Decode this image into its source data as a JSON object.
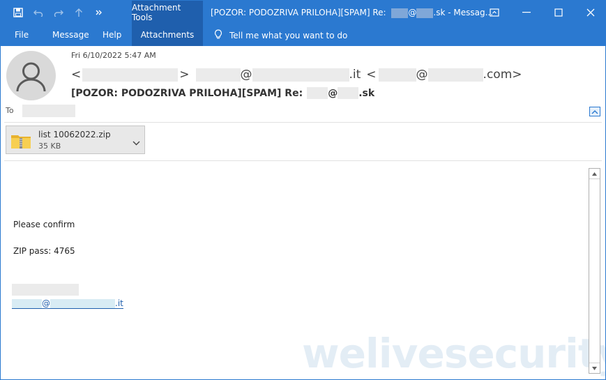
{
  "titlebar": {
    "context_tab": "Attachment Tools",
    "title_prefix": "[POZOR: PODOZRIVA PRILOHA][SPAM] Re:",
    "title_at": "@",
    "title_suffix": ".sk  -  Messag..."
  },
  "ribbon": {
    "tabs": [
      "File",
      "Message",
      "Help",
      "Attachments"
    ],
    "tell_me": "Tell me what you want to do"
  },
  "header": {
    "date": "Fri 6/10/2022 5:47 AM",
    "from_open1": "<",
    "from_close1": ">",
    "from_at1": "@",
    "from_tld1": ".it",
    "from_open2": "<",
    "from_at2": "@",
    "from_tld2": ".com>",
    "subject_prefix": "[POZOR: PODOZRIVA PRILOHA][SPAM] Re:",
    "subject_at": "@",
    "subject_suffix": ".sk",
    "to_label": "To"
  },
  "attachment": {
    "name": "list 10062022.zip",
    "size": "35 KB"
  },
  "body": {
    "line1": "Please confirm",
    "line2": "ZIP pass: 4765",
    "sig_at": "@",
    "sig_tld": ".it"
  },
  "watermark": {
    "part1": "welive",
    "part2": "security"
  },
  "colors": {
    "titlebar": "#2b79d0",
    "context_tab": "#1f5fad",
    "link": "#1f5fad"
  }
}
